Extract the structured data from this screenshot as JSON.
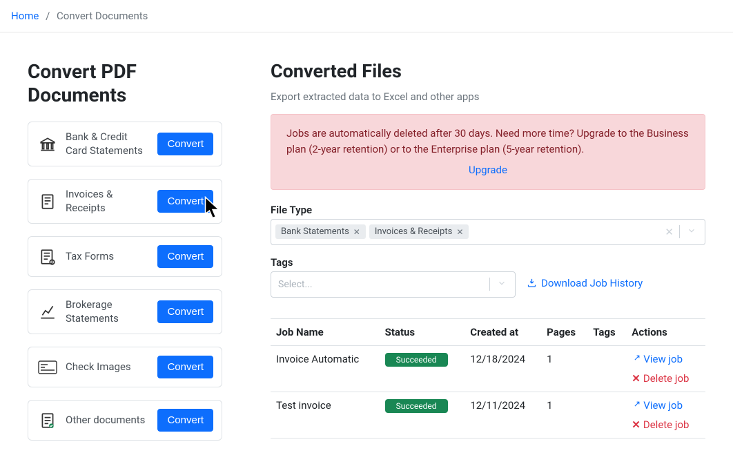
{
  "breadcrumb": {
    "home": "Home",
    "current": "Convert Documents"
  },
  "left": {
    "title": "Convert PDF Documents",
    "button": "Convert",
    "items": [
      {
        "label": "Bank & Credit Card Statements"
      },
      {
        "label": "Invoices & Receipts"
      },
      {
        "label": "Tax Forms"
      },
      {
        "label": "Brokerage Statements"
      },
      {
        "label": "Check Images"
      },
      {
        "label": "Other documents"
      }
    ]
  },
  "right": {
    "title": "Converted Files",
    "subtitle": "Export extracted data to Excel and other apps",
    "alert": {
      "text": "Jobs are automatically deleted after 30 days. Need more time? Upgrade to the Business plan (2-year retention) or to the Enterprise plan (5-year retention).",
      "upgrade": "Upgrade"
    },
    "filetype": {
      "label": "File Type",
      "pills": [
        "Bank Statements",
        "Invoices & Receipts"
      ]
    },
    "tags": {
      "label": "Tags",
      "placeholder": "Select..."
    },
    "download": "Download Job History",
    "table": {
      "headers": {
        "job": "Job Name",
        "status": "Status",
        "created": "Created at",
        "pages": "Pages",
        "tags": "Tags",
        "actions": "Actions"
      },
      "rows": [
        {
          "job": "Invoice Automatic",
          "status": "Succeeded",
          "created": "12/18/2024",
          "pages": "1",
          "tags": ""
        },
        {
          "job": "Test invoice",
          "status": "Succeeded",
          "created": "12/11/2024",
          "pages": "1",
          "tags": ""
        }
      ],
      "actions": {
        "view": "View job",
        "delete": "Delete job"
      }
    }
  }
}
